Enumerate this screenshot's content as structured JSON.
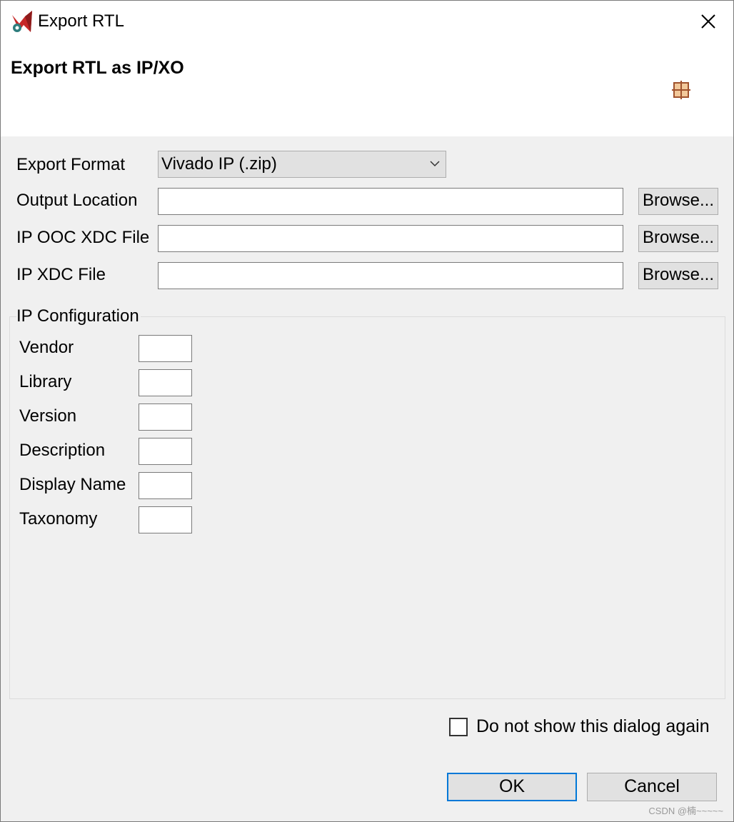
{
  "window": {
    "title": "Export RTL",
    "header_title": "Export RTL as IP/XO"
  },
  "form": {
    "export_format": {
      "label": "Export Format",
      "value": "Vivado IP (.zip)"
    },
    "output_location": {
      "label": "Output Location",
      "value": "",
      "browse_label": "Browse..."
    },
    "ooc_xdc": {
      "label": "IP OOC XDC File",
      "value": "",
      "browse_label": "Browse..."
    },
    "xdc": {
      "label": "IP XDC File",
      "value": "",
      "browse_label": "Browse..."
    }
  },
  "ip_config": {
    "title": "IP Configuration",
    "fields": [
      {
        "label": "Vendor",
        "value": ""
      },
      {
        "label": "Library",
        "value": ""
      },
      {
        "label": "Version",
        "value": ""
      },
      {
        "label": "Description",
        "value": ""
      },
      {
        "label": "Display Name",
        "value": ""
      },
      {
        "label": "Taxonomy",
        "value": ""
      }
    ]
  },
  "footer": {
    "checkbox_label": "Do not show this dialog again",
    "checkbox_checked": false,
    "ok_label": "OK",
    "cancel_label": "Cancel",
    "watermark": "CSDN @楠~~~~~"
  },
  "colors": {
    "dialog_bg": "#f0f0f0",
    "header_bg": "#ffffff",
    "default_button_border": "#0078d7"
  }
}
